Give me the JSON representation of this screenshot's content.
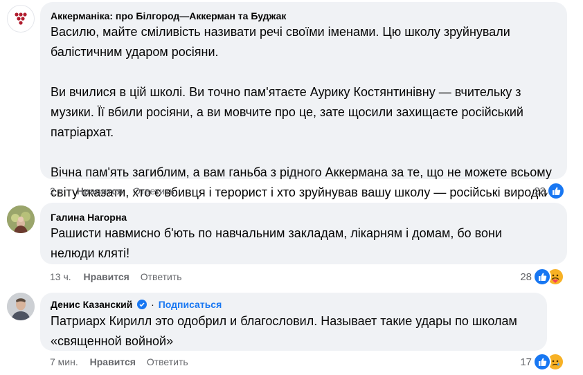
{
  "comments": [
    {
      "author": "Аккерманіка: про Білгород—Аккерман та Буджак",
      "paragraphs": [
        "Василю, майте сміливість називати речі своїми іменами. Цю школу зруйнували балістичним ударом росіяни.",
        "Ви вчилися в цій школі. Ви точно пам'ятаєте Аурику Костянтинівну — вчительку з музики. Її вбили росіяни, а ви мовчите про це, зате щосили захищаєте російський патріархат.",
        "Вічна пам'ять загиблим, а вам ганьба з рідного Аккермана за те, що не можете всьому світу сказати, хто є вбивця і терорист і хто зруйнував вашу школу — російські виродки."
      ],
      "time": "2 ч.",
      "like_label": "Нравится",
      "reply_label": "Ответить",
      "reaction_count": "23",
      "reactions": [
        "like-icon"
      ]
    },
    {
      "author": "Галина Нагорна",
      "text": "Рашисти навмисно б'ють по навчальним закладам, лікарням і домам, бо вони нелюди кляті!",
      "time": "13 ч.",
      "like_label": "Нравится",
      "reply_label": "Ответить",
      "reaction_count": "28",
      "reactions": [
        "like-icon",
        "care-icon"
      ]
    },
    {
      "author": "Денис Казанский",
      "follow_label": "Подписаться",
      "separator": "·",
      "text": "Патриарх Кирилл это одобрил и благословил. Называет такие удары по школам «священной войной»",
      "time": "7 мин.",
      "like_label": "Нравится",
      "reply_label": "Ответить",
      "reaction_count": "17",
      "reactions": [
        "like-icon",
        "sad-icon"
      ]
    }
  ],
  "colors": {
    "bubble": "#f0f2f5",
    "like_blue": "#1877f2",
    "meta_gray": "#65676b",
    "care_yellow": "#f7b125",
    "logo_red": "#b01c2e"
  }
}
